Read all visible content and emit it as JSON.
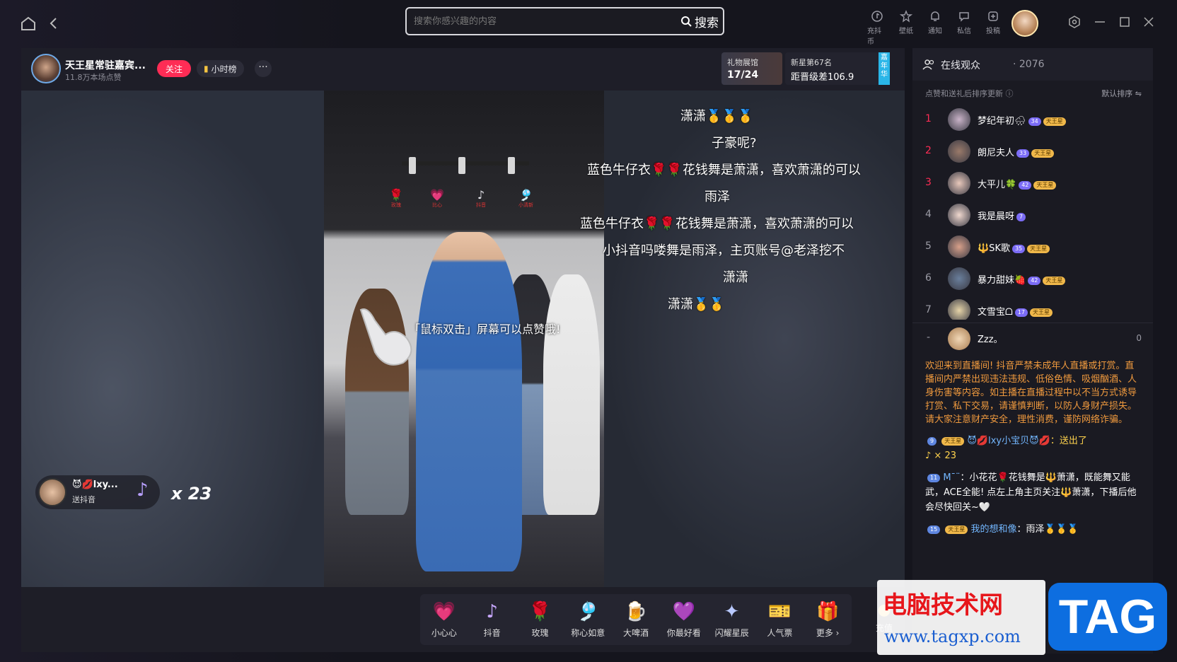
{
  "search": {
    "placeholder": "搜索你感兴趣的内容",
    "button_label": "搜索"
  },
  "toolbar": [
    {
      "label": "充抖币",
      "icon": "tiktok-coin-icon"
    },
    {
      "label": "壁纸",
      "icon": "wallpaper-icon"
    },
    {
      "label": "通知",
      "icon": "bell-icon"
    },
    {
      "label": "私信",
      "icon": "message-icon"
    },
    {
      "label": "投稿",
      "icon": "upload-icon"
    }
  ],
  "stream": {
    "host_name": "天王星常驻嘉宾...",
    "likes": "11.8万本场点赞",
    "follow_label": "关注",
    "rank_label": "小时榜",
    "more_label": "···",
    "gift_hall": {
      "title": "礼物展馆",
      "progress": "17/24"
    },
    "newstar": {
      "title": "新星第67名",
      "gap": "距晋级差106.9",
      "tag": "嘉年华"
    }
  },
  "video": {
    "mini_gifts": [
      "玫瑰",
      "比心",
      "抖音",
      "小清新"
    ],
    "double_click_tip": "「鼠标双击」屏幕可以点赞哦!",
    "danmu": [
      "潇潇🥇🥇🥇",
      "子豪呢?",
      "蓝色牛仔衣🌹🌹花钱舞是萧潇，喜欢萧潇的可以",
      "雨泽",
      "蓝色牛仔衣🌹🌹花钱舞是萧潇，喜欢萧潇的可以",
      "小抖音吗喽舞是雨泽，主页账号@老泽挖不",
      "潇潇",
      "潇潇🥇🥇"
    ],
    "gift_popup": {
      "user": "😈💋lxy...",
      "action": "送抖音",
      "count": "x 23"
    }
  },
  "gift_bar": {
    "gifts": [
      {
        "label": "小心心",
        "icon": "💗"
      },
      {
        "label": "抖音",
        "icon": "♪"
      },
      {
        "label": "玫瑰",
        "icon": "🌹"
      },
      {
        "label": "称心如意",
        "icon": "🎐"
      },
      {
        "label": "大啤酒",
        "icon": "🍺"
      },
      {
        "label": "你最好看",
        "icon": "💜"
      },
      {
        "label": "闪耀星辰",
        "icon": "✦"
      },
      {
        "label": "人气票",
        "icon": "🎫"
      },
      {
        "label": "更多 ›",
        "icon": "🎁"
      }
    ],
    "charge_label": "充值"
  },
  "audience": {
    "title": "在线观众",
    "count": "· 2076",
    "subtitle": "点赞和送礼后排序更新 ⓘ",
    "sort_label": "默认排序 ⇋",
    "list": [
      {
        "rank": "1",
        "name": "梦纪年初🌧",
        "level": "34",
        "fan": "天王星",
        "avatar_color": "#c9b3c8"
      },
      {
        "rank": "2",
        "name": "朗尼夫人",
        "level": "33",
        "fan": "天王星",
        "avatar_color": "#9a7a6a"
      },
      {
        "rank": "3",
        "name": "大平儿🍀",
        "level": "42",
        "fan": "天王星",
        "avatar_color": "#e8c8bb"
      },
      {
        "rank": "4",
        "name": "我是晨呀",
        "level": "7",
        "fan": "",
        "avatar_color": "#f0d8cf"
      },
      {
        "rank": "5",
        "name": "🔱SK歌",
        "level": "35",
        "fan": "天王星",
        "avatar_color": "#d8a08a"
      },
      {
        "rank": "6",
        "name": "暴力甜妹🍓",
        "level": "42",
        "fan": "天王星",
        "avatar_color": "#6a7f9c"
      },
      {
        "rank": "7",
        "name": "文雪宝ᗝ",
        "level": "17",
        "fan": "天王星",
        "avatar_color": "#e6d4a8"
      }
    ],
    "self": {
      "rank": "-",
      "name": "Zzz。",
      "score": "0"
    }
  },
  "chat": {
    "notice": "欢迎来到直播间! 抖音严禁未成年人直播或打赏。直播间内严禁出现违法违规、低俗色情、吸烟酗酒、人身伤害等内容。如主播在直播过程中以不当方式诱导打赏、私下交易，请谨慎判断，以防人身财产损失。请大家注意财产安全，理性消费，谨防网络诈骗。",
    "messages": [
      {
        "level": "9",
        "fan": "天王星",
        "user": "😈💋lxy小宝贝😈💋",
        "text": "：送出了",
        "extra": "♪ × 23"
      },
      {
        "level": "11",
        "fan": "",
        "user": "M¯¨",
        "text": "：小花花🌹花钱舞是🔱萧潇，既能舞又能武，ACE全能! 点左上角主页关注🔱萧潇，下播后他会尽快回关~🤍",
        "extra": ""
      },
      {
        "level": "15",
        "fan": "天王星",
        "user": "我的想和像",
        "text": "：雨泽🥇🥇🥇",
        "extra": ""
      }
    ]
  },
  "watermark": {
    "title": "电脑技术网",
    "url": "www.tagxp.com",
    "tag": "TAG"
  },
  "colors": {
    "accent": "#fe2c55",
    "notice": "#f09a3e",
    "username": "#73b7ff"
  }
}
